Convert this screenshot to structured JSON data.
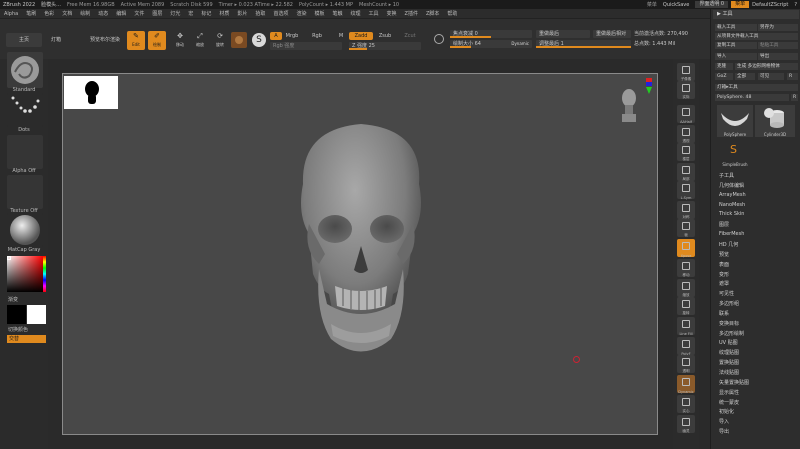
{
  "titlebar": {
    "app": "ZBrush 2022",
    "doc": "脸模头...",
    "free_mem": "Free Mem 16.98GB",
    "active_mem": "Active Mem 2089",
    "scratch": "Scratch Disk 599",
    "timer": "Timer ▸ 0.023 ATime ▸ 22.582",
    "polycount": "PolyCount ▸ 1.443 MP",
    "meshcount": "MeshCount ▸ 10",
    "menu_label": "菜单",
    "quicksave": "QuickSave",
    "transparency": "界面透明 0",
    "menus_btn": "菜单",
    "script": "DefaultZScript"
  },
  "menubar": [
    "Alpha",
    "笔刷",
    "色彩",
    "文档",
    "绘制",
    "动态",
    "编辑",
    "文件",
    "图层",
    "灯光",
    "宏",
    "标记",
    "材质",
    "影片",
    "拾取",
    "首选项",
    "渲染",
    "模板",
    "笔触",
    "纹理",
    "工具",
    "变换",
    "Z插件",
    "Z脚本",
    "帮助"
  ],
  "toolbar": {
    "home": "主页",
    "lightbox": "灯箱",
    "preview": "预览布尔渲染",
    "edit": "Edit",
    "draw": "绘制",
    "move": "移动",
    "scale": "缩放",
    "rotate": "旋转",
    "mode_a": "A",
    "mrgb": "Mrgb",
    "rgb": "Rgb",
    "m": "M",
    "rgb_intensity": "Rgb 强度",
    "zadd": "Zadd",
    "zsub": "Zsub",
    "zcut": "Zcut",
    "z_intensity": "Z 强度 25",
    "focal_shift": "焦点衰减 0",
    "draw_size": "绘制大小 64",
    "dynamic": "Dynamic",
    "reset_top": "重做最后",
    "reset_rel": "重做最后相对",
    "adjust_last": "调整最后 1",
    "active_points": "当前激活点数: 270,490",
    "total_points": "总点数: 1.443 Mil"
  },
  "leftshelf": {
    "brush": "Standard",
    "stroke": "Dots",
    "alpha": "Alpha Off",
    "texture": "Texture Off",
    "material": "MatCap Gray",
    "gradient": "渐变",
    "switch_color": "切换颜色",
    "alternate": "交替"
  },
  "rightshelf": [
    "子像素",
    "实际",
    "AAHalf",
    "透视",
    "楼层",
    "局部",
    "L.Sym",
    "对称",
    "帧",
    "Xpose",
    "移动",
    "缩放",
    "旋转",
    "Line Fill",
    "PolyF",
    "透明",
    "Dynamic",
    "实心",
    "幽灵"
  ],
  "toolpanel": {
    "header": "工具",
    "load_tool": "载入工具",
    "save_as": "另存为",
    "load_from_project": "从项目文件载入工具",
    "copy_tool": "复制工具",
    "paste_tool": "粘贴工具",
    "import": "导入",
    "export": "导出",
    "clone": "克隆",
    "make_polymesh": "生成 多边形网格物体",
    "goz": "GoZ",
    "all": "全部",
    "visible": "可见",
    "r": "R",
    "lightbox_tools": "灯箱▸工具",
    "polysphere": "PolySphere. 48",
    "r2": "R",
    "thumbs": [
      "PolySphere",
      "Cylinder3D",
      "SimpleBrush"
    ],
    "subtool_list": [
      "子工具",
      "几何体编辑",
      "ArrayMesh",
      "NanoMesh",
      "Thick Skin",
      "图层",
      "FiberMesh",
      "HD 几何",
      "预览",
      "表面",
      "变形",
      "遮罩",
      "可见性",
      "多边形组",
      "联系",
      "变换目标",
      "多边形绘制",
      "UV 贴图",
      "纹理贴图",
      "置换贴图",
      "法线贴图",
      "矢量置换贴图",
      "显示属性",
      "统一蒙皮",
      "初始化",
      "导入",
      "导出"
    ]
  }
}
